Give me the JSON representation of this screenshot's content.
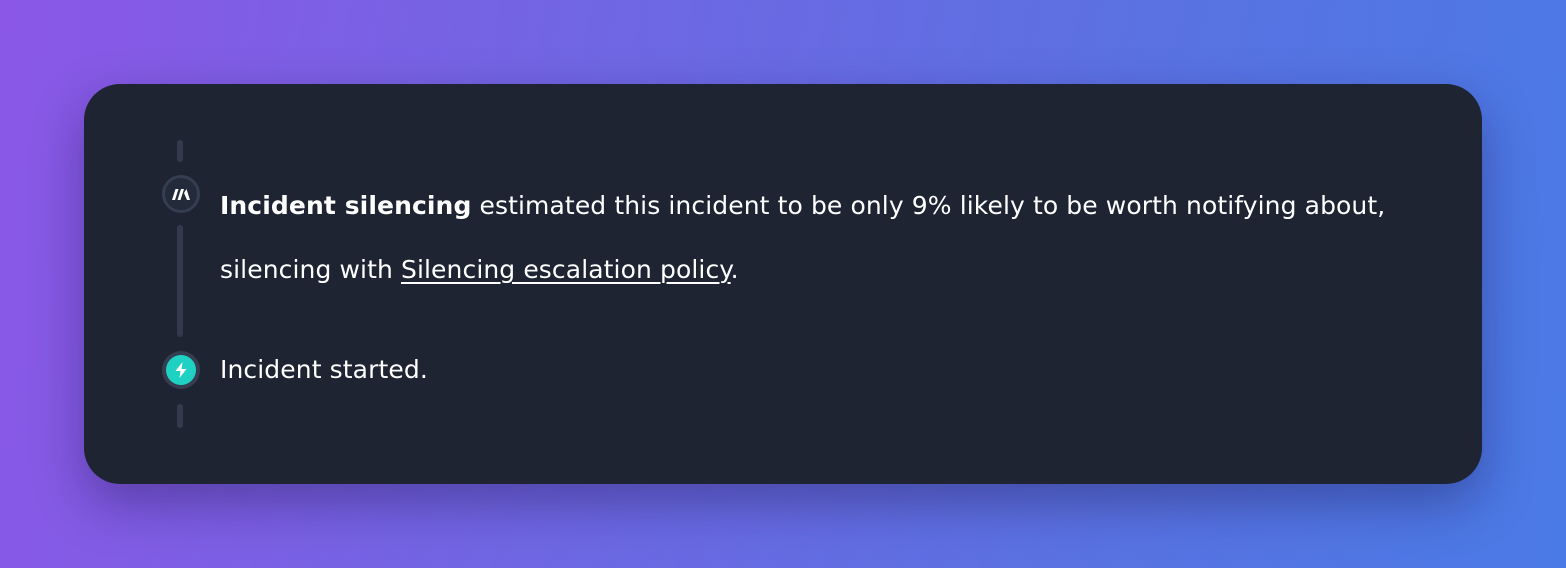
{
  "timeline": {
    "entries": [
      {
        "icon": "incident-io-logo-icon",
        "bold": "Incident silencing",
        "text_before_link": " estimated this incident to be only 9% likely to be worth notifying about, silencing with ",
        "link": "Silencing escalation policy",
        "text_after_link": "."
      },
      {
        "icon": "lightning-bolt-icon",
        "text": "Incident started."
      }
    ]
  },
  "colors": {
    "card_background": "#1f2433",
    "rail": "#323a4c",
    "bolt_accent": "#1fd1c2",
    "text": "#ffffff"
  }
}
